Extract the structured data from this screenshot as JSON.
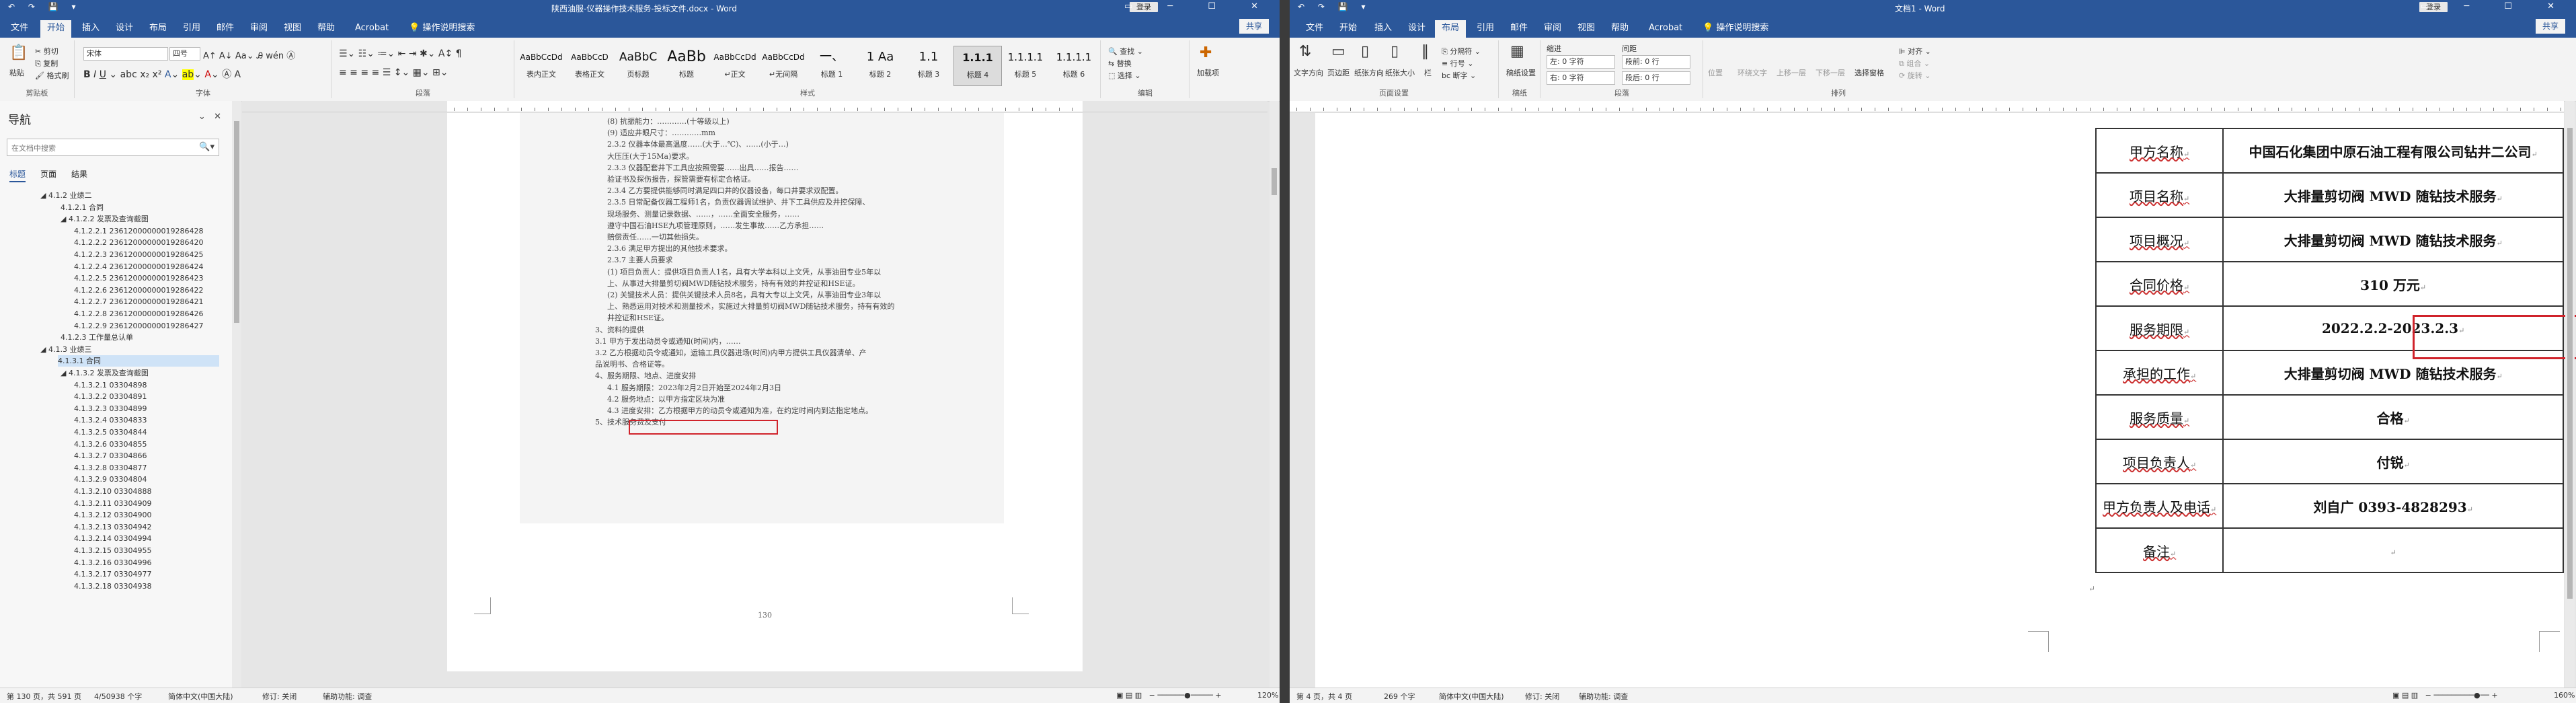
{
  "win1": {
    "title": "陕西油服-仪器操作技术服务-投标文件.docx - Word",
    "qat": "↶ ↷ 💾 ▾",
    "login": "登录",
    "tabs": [
      "文件",
      "开始",
      "插入",
      "设计",
      "布局",
      "引用",
      "邮件",
      "审阅",
      "视图",
      "帮助",
      "Acrobat",
      "💡 操作说明搜索"
    ],
    "active_tab": "开始",
    "share": "共享",
    "ribbon": {
      "paste": "粘贴",
      "cut": "剪切",
      "copy": "复制",
      "format_painter": "格式刷",
      "clipboard": "剪贴板",
      "font_name": "宋体",
      "font_size": "四号",
      "font_group": "字体",
      "paragraph_group": "段落",
      "styles_group": "样式",
      "styles": [
        {
          "preview": "AaBbCcDd",
          "name": "表内正文"
        },
        {
          "preview": "AaBbCcD",
          "name": "表格正文"
        },
        {
          "preview": "AaBbC",
          "name": "页标题"
        },
        {
          "preview": "AaBb",
          "name": "标题"
        },
        {
          "preview": "AaBbCcDd",
          "name": "↵正文"
        },
        {
          "preview": "AaBbCcDd",
          "name": "↵无间隔"
        },
        {
          "preview": "一、",
          "name": "标题 1"
        },
        {
          "preview": "1 Aa",
          "name": "标题 2"
        },
        {
          "preview": "1.1",
          "name": "标题 3"
        },
        {
          "preview": "1.1.1",
          "name": "标题 4"
        },
        {
          "preview": "1.1.1.1",
          "name": "标题 5"
        },
        {
          "preview": "1.1.1.1",
          "name": "标题 6"
        }
      ],
      "find": "查找",
      "replace": "替换",
      "select": "选择",
      "edit_group": "编辑",
      "addin": "加载项"
    },
    "nav": {
      "title": "导航",
      "search_placeholder": "在文档中搜索",
      "tabs": [
        "标题",
        "页面",
        "结果"
      ],
      "items": [
        {
          "level": 2,
          "text": "◢ 4.1.2 业绩二"
        },
        {
          "level": 3,
          "text": "4.1.2.1 合同"
        },
        {
          "level": 3,
          "text": "◢ 4.1.2.2 发票及查询截图"
        },
        {
          "level": 4,
          "text": "4.1.2.2.1 23612000000019286428"
        },
        {
          "level": 4,
          "text": "4.1.2.2.2 23612000000019286420"
        },
        {
          "level": 4,
          "text": "4.1.2.2.3 23612000000019286425"
        },
        {
          "level": 4,
          "text": "4.1.2.2.4 23612000000019286424"
        },
        {
          "level": 4,
          "text": "4.1.2.2.5 23612000000019286423"
        },
        {
          "level": 4,
          "text": "4.1.2.2.6 23612000000019286422"
        },
        {
          "level": 4,
          "text": "4.1.2.2.7 23612000000019286421"
        },
        {
          "level": 4,
          "text": "4.1.2.2.8 23612000000019286426"
        },
        {
          "level": 4,
          "text": "4.1.2.2.9 23612000000019286427"
        },
        {
          "level": 3,
          "text": "4.1.2.3 工作量总认单"
        },
        {
          "level": 2,
          "text": "◢ 4.1.3 业绩三"
        },
        {
          "level": 3,
          "text": "4.1.3.1 合同",
          "selected": true
        },
        {
          "level": 3,
          "text": "◢ 4.1.3.2 发票及查询截图"
        },
        {
          "level": 4,
          "text": "4.1.3.2.1 03304898"
        },
        {
          "level": 4,
          "text": "4.1.3.2.2 03304891"
        },
        {
          "level": 4,
          "text": "4.1.3.2.3 03304899"
        },
        {
          "level": 4,
          "text": "4.1.3.2.4 03304833"
        },
        {
          "level": 4,
          "text": "4.1.3.2.5 03304844"
        },
        {
          "level": 4,
          "text": "4.1.3.2.6 03304855"
        },
        {
          "level": 4,
          "text": "4.1.3.2.7 03304866"
        },
        {
          "level": 4,
          "text": "4.1.3.2.8 03304877"
        },
        {
          "level": 4,
          "text": "4.1.3.2.9 03304804"
        },
        {
          "level": 4,
          "text": "4.1.3.2.10 03304888"
        },
        {
          "level": 4,
          "text": "4.1.3.2.11 03304909"
        },
        {
          "level": 4,
          "text": "4.1.3.2.12 03304900"
        },
        {
          "level": 4,
          "text": "4.1.3.2.13 03304942"
        },
        {
          "level": 4,
          "text": "4.1.3.2.14 03304994"
        },
        {
          "level": 4,
          "text": "4.1.3.2.15 03304955"
        },
        {
          "level": 4,
          "text": "4.1.3.2.16 03304996"
        },
        {
          "level": 4,
          "text": "4.1.3.2.17 03304977"
        },
        {
          "level": 4,
          "text": "4.1.3.2.18 03304938"
        }
      ]
    },
    "doc_lines": [
      "(8) 抗振能力：…………(十等级以上)",
      "(9) 适应井眼尺寸：…………mm",
      "2.3.2 仪器本体最高温度……(大于…℃)、……(小于…)",
      "大压压(大于15Ma)要求。",
      "2.3.3 仪器配套井下工具应按照需要……出具……报告……",
      "验证书及探伤报告，探管需要有标定合格证。",
      "2.3.4 乙方要提供能够同时满足四口井的仪器设备，每口井要求双配置。",
      "2.3.5 日常配备仪器工程师1名，负责仪器调试维护、井下工具供应及井控保障、",
      "现场服务、测量记录数据、……，……全面安全服务，……",
      "遵守中国石油HSE九项管理原则，……发生事故……乙方承担……",
      "赔偿责任……一切其他损失。",
      "2.3.6 满足甲方提出的其他技术要求。",
      "2.3.7 主要人员要求",
      "(1) 项目负责人：提供项目负责人1名，具有大学本科以上文凭，从事油田专业5年以",
      "上、从事过大排量剪切阀MWD随钻技术服务，持有有效的井控证和HSE证。",
      "(2) 关键技术人员：提供关键技术人员8名，具有大专以上文凭，从事油田专业3年以",
      "上、熟悉运用对技术和测量技术，实施过大排量剪切阀MWD随钻技术服务，持有有效的",
      "井控证和HSE证。",
      "3、资料的提供",
      "3.1 甲方于发出动员令或通知(时间)内，……",
      "3.2 乙方根据动员令或通知，运输工具仪器进场(时间)内甲方提供工具仪器清单、产",
      "品说明书、合格证等。",
      "4、服务期限、地点、进度安排",
      "4.1 服务期限：2023年2月2日开始至2024年2月3日",
      "4.2 服务地点：以甲方指定区块为准",
      "4.3 进度安排：乙方根据甲方的动员令或通知为准，在约定时间内到达指定地点。",
      "5、技术服务费及支付"
    ],
    "red_line_index": 23,
    "page_number": "130",
    "status": {
      "page": "第 130 页，共 591 页",
      "words": "4/50938 个字",
      "lang": "简体中文(中国大陆)",
      "track": "修订: 关闭",
      "access": "辅助功能: 调查",
      "zoom": "120%"
    }
  },
  "win2": {
    "title": "文档1 - Word",
    "login": "登录",
    "qat": "↶ ↷ 💾 ▾",
    "tabs": [
      "文件",
      "开始",
      "插入",
      "设计",
      "布局",
      "引用",
      "邮件",
      "审阅",
      "视图",
      "帮助",
      "Acrobat",
      "💡 操作说明搜索"
    ],
    "active_tab": "布局",
    "share": "共享",
    "ribbon": {
      "text_dir": "文字方向",
      "margins": "页边距",
      "orient": "纸张方向",
      "size": "纸张大小",
      "cols": "栏",
      "breaks": "分隔符",
      "linenum": "行号",
      "hyph": "断字",
      "page_setup": "页面设置",
      "draft": "稿纸设置",
      "draft_group": "稿纸",
      "indent": "缩进",
      "spacing": "间距",
      "left": "左: 0 字符",
      "right": "右: 0 字符",
      "before": "段前: 0 行",
      "after": "段后: 0 行",
      "para_group": "段落",
      "position": "位置",
      "wrap": "环绕文字",
      "forward": "上移一层",
      "backward": "下移一层",
      "pane": "选择窗格",
      "align": "对齐",
      "group": "组合",
      "rotate": "旋转",
      "arrange": "排列"
    },
    "table": [
      {
        "label": "甲方名称",
        "value": "中国石化集团中原石油工程有限公司钻井二公司"
      },
      {
        "label": "项目名称",
        "value": "大排量剪切阀 MWD 随钻技术服务"
      },
      {
        "label": "项目概况",
        "value": "大排量剪切阀 MWD 随钻技术服务"
      },
      {
        "label": "合同价格",
        "value": "310 万元"
      },
      {
        "label": "服务期限",
        "value": "2022.2.2-2023.2.3",
        "highlight": true
      },
      {
        "label": "承担的工作",
        "value": "大排量剪切阀 MWD 随钻技术服务"
      },
      {
        "label": "服务质量",
        "value": "合格"
      },
      {
        "label": "项目负责人",
        "value": "付锐"
      },
      {
        "label": "甲方负责人及电话",
        "value": "刘自广 0393-4828293"
      },
      {
        "label": "备注",
        "value": ""
      }
    ],
    "cell_mark": "↵",
    "status": {
      "page": "第 4 页，共 4 页",
      "words": "269 个字",
      "lang": "简体中文(中国大陆)",
      "track": "修订: 关闭",
      "access": "辅助功能: 调查",
      "zoom": "160%"
    }
  },
  "colors": {
    "word_blue": "#2b579a",
    "highlight_red": "#d0232b"
  }
}
